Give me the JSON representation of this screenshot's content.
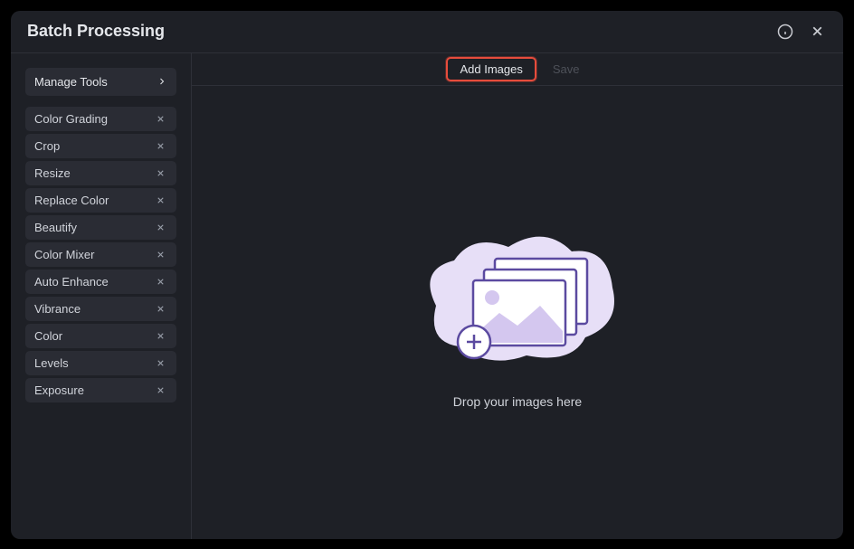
{
  "header": {
    "title": "Batch Processing"
  },
  "sidebar": {
    "manageToolsLabel": "Manage Tools",
    "tools": [
      {
        "label": "Color Grading"
      },
      {
        "label": "Crop"
      },
      {
        "label": "Resize"
      },
      {
        "label": "Replace Color"
      },
      {
        "label": "Beautify"
      },
      {
        "label": "Color Mixer"
      },
      {
        "label": "Auto Enhance"
      },
      {
        "label": "Vibrance"
      },
      {
        "label": "Color"
      },
      {
        "label": "Levels"
      },
      {
        "label": "Exposure"
      }
    ]
  },
  "toolbar": {
    "addImagesLabel": "Add Images",
    "saveLabel": "Save"
  },
  "dropArea": {
    "text": "Drop your images here"
  }
}
